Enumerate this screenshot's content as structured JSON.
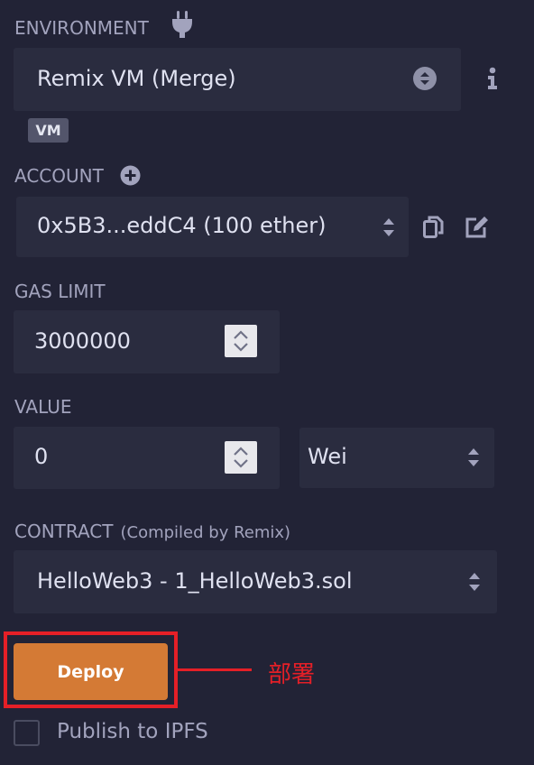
{
  "environment": {
    "label": "ENVIRONMENT",
    "selected": "Remix VM (Merge)",
    "badge": "VM"
  },
  "account": {
    "label": "ACCOUNT",
    "selected": "0x5B3...eddC4 (100 ether)"
  },
  "gas_limit": {
    "label": "GAS LIMIT",
    "value": "3000000"
  },
  "value": {
    "label": "VALUE",
    "amount": "0",
    "unit": "Wei"
  },
  "contract": {
    "label": "CONTRACT",
    "sublabel": "(Compiled by Remix)",
    "selected": "HelloWeb3 - 1_HelloWeb3.sol"
  },
  "deploy": {
    "label": "Deploy",
    "annotation": "部署"
  },
  "publish": {
    "label": "Publish to IPFS",
    "checked": false
  },
  "colors": {
    "background": "#222336",
    "field": "#2a2c3f",
    "deploy_button": "#d47a35",
    "annotation_red": "#e51f27"
  },
  "icons": {
    "environment": "plug-icon",
    "info": "info-icon",
    "account_add": "plus-circle-icon",
    "copy": "copy-icon",
    "edit": "edit-icon",
    "select_arrows": "sort-arrows-icon"
  }
}
